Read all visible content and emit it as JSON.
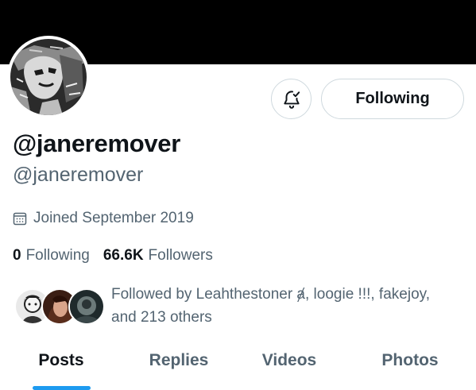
{
  "profile": {
    "display_name": "@janeremover",
    "handle": "@janeremover",
    "joined": "Joined September 2019"
  },
  "actions": {
    "notify_icon": "bell-check-icon",
    "follow_label": "Following"
  },
  "stats": {
    "following_count": "0",
    "following_label": "Following",
    "followers_count": "66.6K",
    "followers_label": "Followers"
  },
  "followed_by": {
    "text_line1": "Followed by Leahthestoner ⱥ, loogie !!!, fakejoy,",
    "text_line2": "and 213 others"
  },
  "tabs": [
    {
      "label": "Posts",
      "active": true
    },
    {
      "label": "Replies",
      "active": false
    },
    {
      "label": "Videos",
      "active": false
    },
    {
      "label": "Photos",
      "active": false
    }
  ],
  "colors": {
    "banner": "#000000",
    "accent": "#1d9bf0",
    "secondary_text": "#536471",
    "primary_text": "#0f1419",
    "border": "#cfd9de"
  }
}
